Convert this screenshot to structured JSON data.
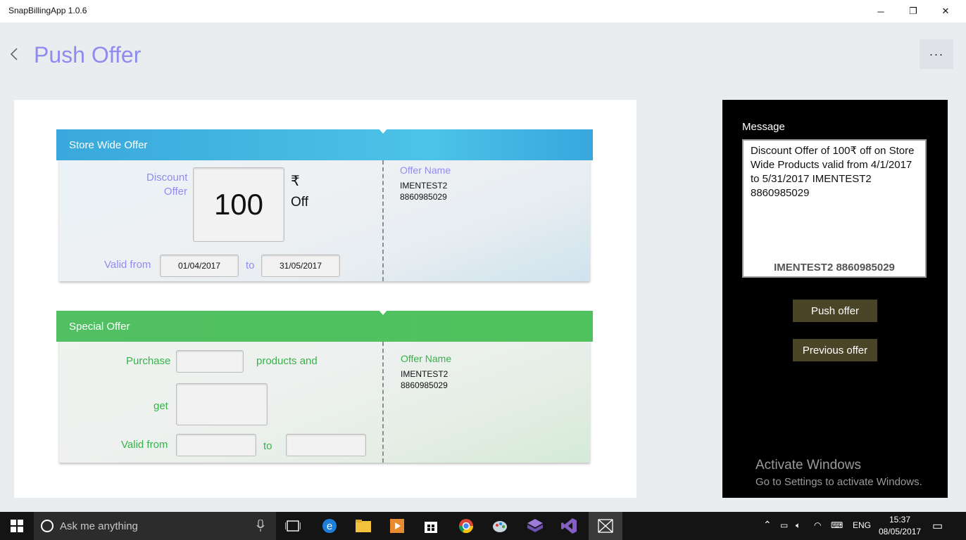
{
  "window": {
    "title": "SnapBillingApp 1.0.6",
    "minimize": "─",
    "restore": "❐",
    "close": "✕"
  },
  "header": {
    "title": "Push Offer",
    "more": "···"
  },
  "store_offer": {
    "title": "Store Wide Offer",
    "discount_label_1": "Discount",
    "discount_label_2": "Offer",
    "discount_value": "100",
    "currency": "₹",
    "off": "Off",
    "valid_from_label": "Valid from",
    "from_date": "01/04/2017",
    "to_label": "to",
    "to_date": "31/05/2017",
    "offer_name_label": "Offer Name",
    "offer_name_1": "IMENTEST2",
    "offer_name_2": "8860985029"
  },
  "special_offer": {
    "title": "Special Offer",
    "purchase_label": "Purchase",
    "products_and_label": "products and",
    "get_label": "get",
    "valid_from_label": "Valid from",
    "to_label": "to",
    "offer_name_label": "Offer Name",
    "offer_name_1": "IMENTEST2",
    "offer_name_2": "8860985029"
  },
  "sidebar": {
    "message_label": "Message",
    "message_text": "Discount Offer of 100₹ off on Store Wide Products valid from 4/1/2017 to 5/31/2017 IMENTEST2 8860985029",
    "signature": "IMENTEST2 8860985029",
    "push_button": "Push offer",
    "previous_button": "Previous offer"
  },
  "watermark": {
    "line1": "Activate Windows",
    "line2": "Go to Settings to activate Windows."
  },
  "taskbar": {
    "search_placeholder": "Ask me anything",
    "language": "ENG",
    "time": "15:37",
    "date": "08/05/2017"
  },
  "colors": {
    "accent_purple": "#8f8cf0",
    "store_blue": "#4cc3e8",
    "special_green": "#4fc25d",
    "button_olive": "#4a4526"
  }
}
